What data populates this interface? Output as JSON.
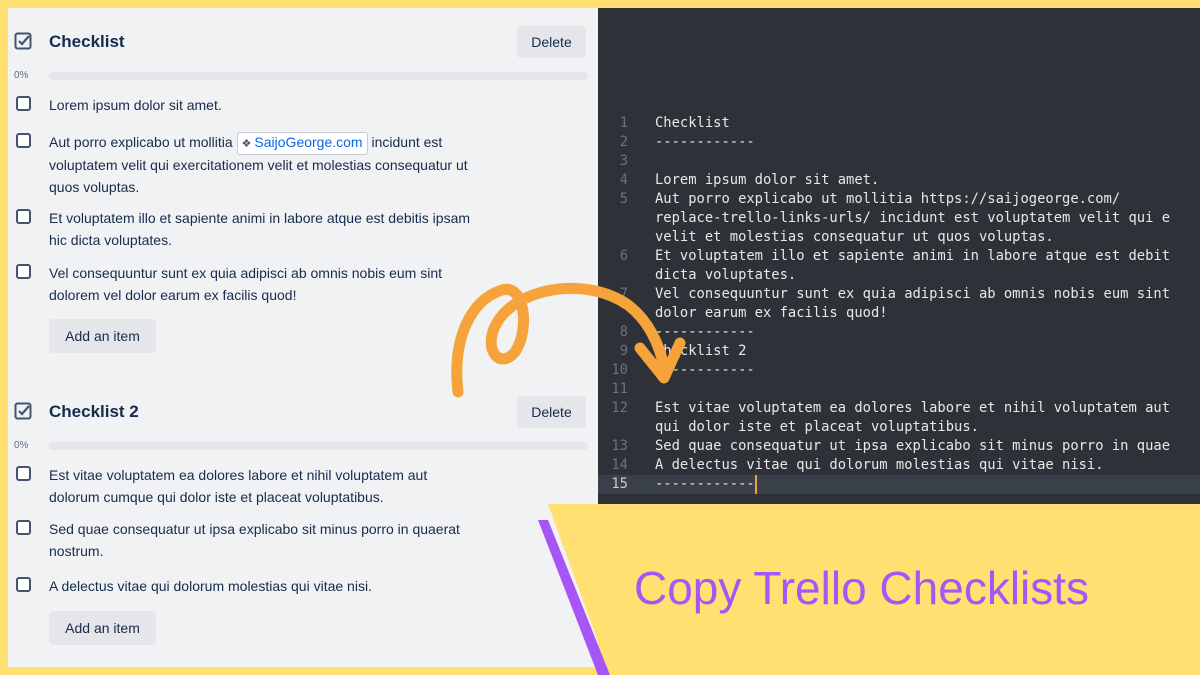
{
  "checklists": [
    {
      "title": "Checklist",
      "delete_label": "Delete",
      "progress_label": "0%",
      "progress": 0,
      "items": [
        {
          "text": "Lorem ipsum dolor sit amet."
        },
        {
          "text_before": "Aut porro explicabo ut mollitia ",
          "link_label": "SaijoGeorge.com",
          "link_icon": "link-icon",
          "text_after": " incidunt est voluptatem velit qui exercitationem velit et molestias consequatur ut quos voluptas."
        },
        {
          "text": "Et voluptatem illo et sapiente animi in labore atque est debitis ipsam hic dicta voluptates."
        },
        {
          "text": "Vel consequuntur sunt ex quia adipisci ab omnis nobis eum sint dolorem vel dolor earum ex facilis quod!"
        }
      ],
      "add_label": "Add an item"
    },
    {
      "title": "Checklist 2",
      "delete_label": "Delete",
      "progress_label": "0%",
      "progress": 0,
      "items": [
        {
          "text": "Est vitae voluptatem ea dolores labore et nihil voluptatem aut dolorum cumque qui dolor iste et placeat voluptatibus."
        },
        {
          "text": "Sed quae consequatur ut ipsa explicabo sit minus porro in quaerat nostrum."
        },
        {
          "text": "A delectus vitae qui dolorum molestias qui vitae nisi."
        }
      ],
      "add_label": "Add an item"
    }
  ],
  "editor": {
    "active_line": "15",
    "lines": [
      {
        "n": "1",
        "text": "Checklist"
      },
      {
        "n": "2",
        "text": "------------"
      },
      {
        "n": "3",
        "text": ""
      },
      {
        "n": "4",
        "text": "Lorem ipsum dolor sit amet."
      },
      {
        "n": "5",
        "text": "Aut porro explicabo ut mollitia https://saijogeorge.com/"
      },
      {
        "n": "",
        "text": "replace-trello-links-urls/ incidunt est voluptatem velit qui e"
      },
      {
        "n": "",
        "text": "velit et molestias consequatur ut quos voluptas."
      },
      {
        "n": "6",
        "text": "Et voluptatem illo et sapiente animi in labore atque est debit"
      },
      {
        "n": "",
        "text": "dicta voluptates."
      },
      {
        "n": "7",
        "text": "Vel consequuntur sunt ex quia adipisci ab omnis nobis eum sint"
      },
      {
        "n": "",
        "text": "dolor earum ex facilis quod!"
      },
      {
        "n": "8",
        "text": "------------"
      },
      {
        "n": "9",
        "text": "Checklist 2"
      },
      {
        "n": "10",
        "text": "------------"
      },
      {
        "n": "11",
        "text": ""
      },
      {
        "n": "12",
        "text": "Est vitae voluptatem ea dolores labore et nihil voluptatem aut"
      },
      {
        "n": "",
        "text": "qui dolor iste et placeat voluptatibus."
      },
      {
        "n": "13",
        "text": "Sed quae consequatur ut ipsa explicabo sit minus porro in quae"
      },
      {
        "n": "14",
        "text": "A delectus vitae qui dolorum molestias qui vitae nisi."
      },
      {
        "n": "15",
        "text": "------------"
      }
    ]
  },
  "banner": {
    "title": "Copy Trello Checklists",
    "title_color": "#a855f7",
    "background_color": "#ffe070",
    "arrow_color": "#f5a33a"
  }
}
